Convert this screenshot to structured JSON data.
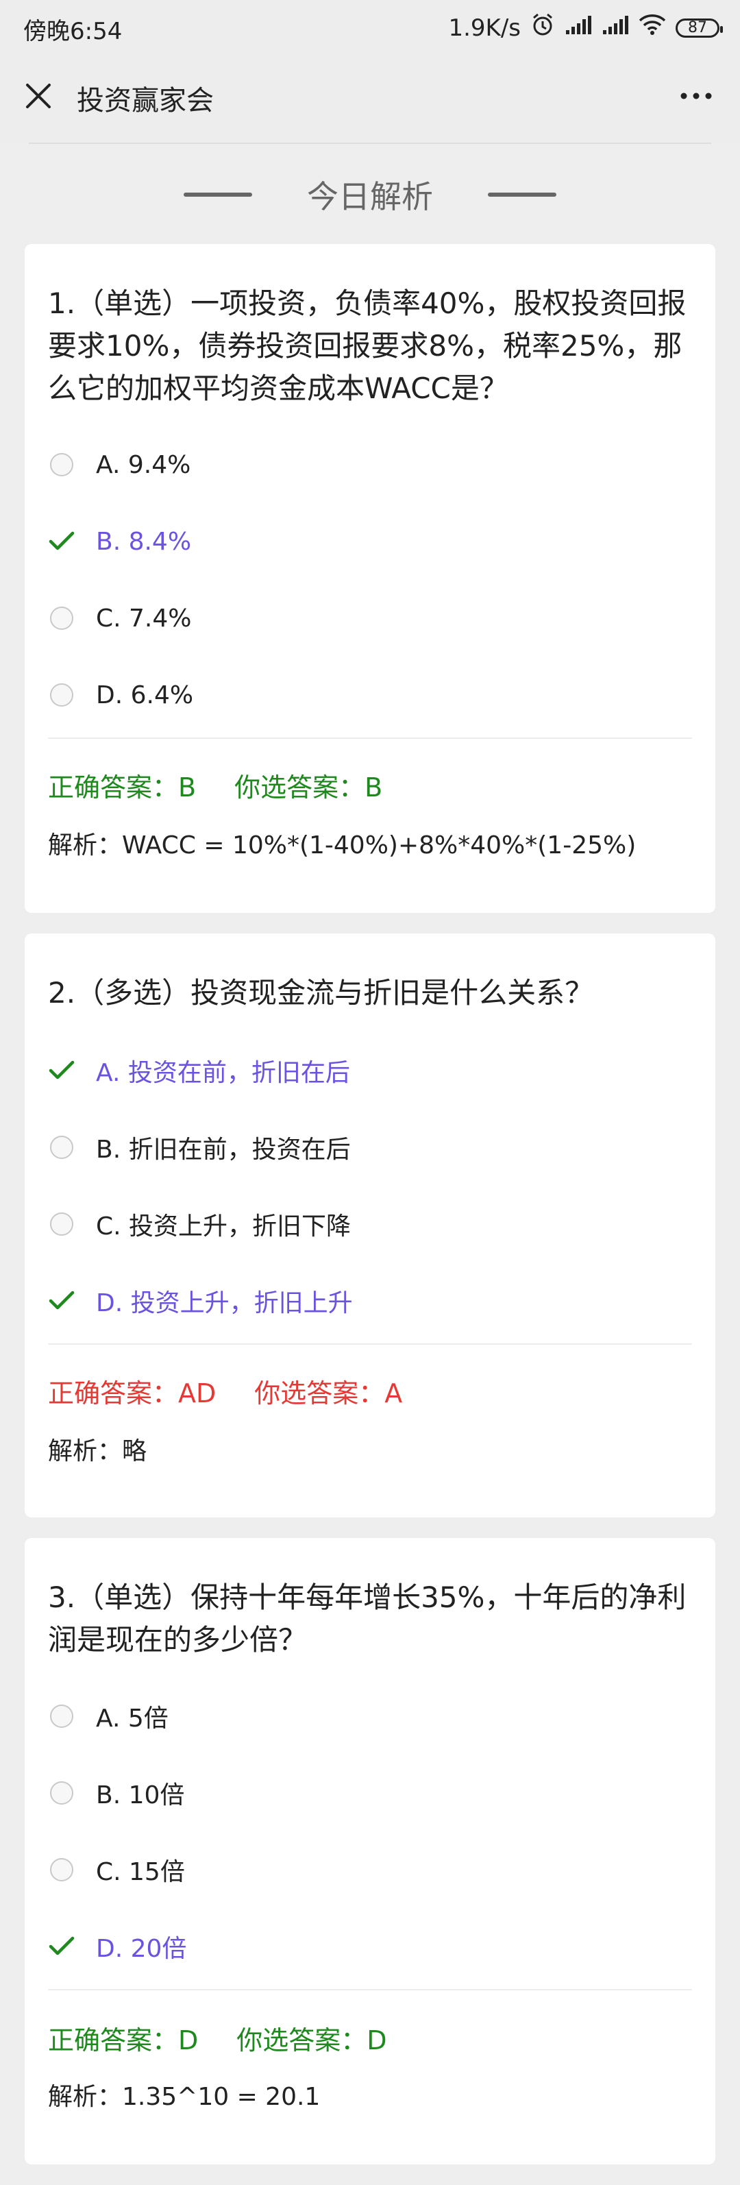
{
  "status_bar": {
    "time": "傍晚6:54",
    "network_speed": "1.9K/s",
    "battery": "87",
    "icons": [
      "alarm-icon",
      "signal-icon",
      "signal-icon",
      "wifi-icon",
      "battery-icon"
    ]
  },
  "header": {
    "title": "投资赢家会",
    "close_icon": "close-icon",
    "more_icon": "more-icon"
  },
  "section_title": "今日解析",
  "colors": {
    "correct": "#1e8a1e",
    "wrong": "#e53935",
    "selected": "#6b53e0"
  },
  "questions": [
    {
      "text": "1.（单选）一项投资，负债率40%，股权投资回报要求10%，债券投资回报要求8%，税率25%，那么它的加权平均资金成本WACC是？",
      "options": [
        {
          "label": "A. 9.4%",
          "selected": false
        },
        {
          "label": "B. 8.4%",
          "selected": true
        },
        {
          "label": "C. 7.4%",
          "selected": false
        },
        {
          "label": "D. 6.4%",
          "selected": false
        }
      ],
      "correct_answer": "正确答案：B",
      "your_answer": "你选答案：B",
      "result": "correct",
      "explanation": "解析：WACC = 10%*(1-40%)+8%*40%*(1-25%)"
    },
    {
      "text": "2.（多选）投资现金流与折旧是什么关系？",
      "options": [
        {
          "label": "A. 投资在前，折旧在后",
          "selected": true
        },
        {
          "label": "B. 折旧在前，投资在后",
          "selected": false
        },
        {
          "label": "C. 投资上升，折旧下降",
          "selected": false
        },
        {
          "label": "D. 投资上升，折旧上升",
          "selected": true
        }
      ],
      "correct_answer": "正确答案：AD",
      "your_answer": "你选答案：A",
      "result": "wrong",
      "explanation": "解析：略"
    },
    {
      "text": "3.（单选）保持十年每年增长35%，十年后的净利润是现在的多少倍？",
      "options": [
        {
          "label": "A. 5倍",
          "selected": false
        },
        {
          "label": "B. 10倍",
          "selected": false
        },
        {
          "label": "C. 15倍",
          "selected": false
        },
        {
          "label": "D. 20倍",
          "selected": true
        }
      ],
      "correct_answer": "正确答案：D",
      "your_answer": "你选答案：D",
      "result": "correct",
      "explanation": "解析：1.35^10 = 20.1"
    }
  ]
}
